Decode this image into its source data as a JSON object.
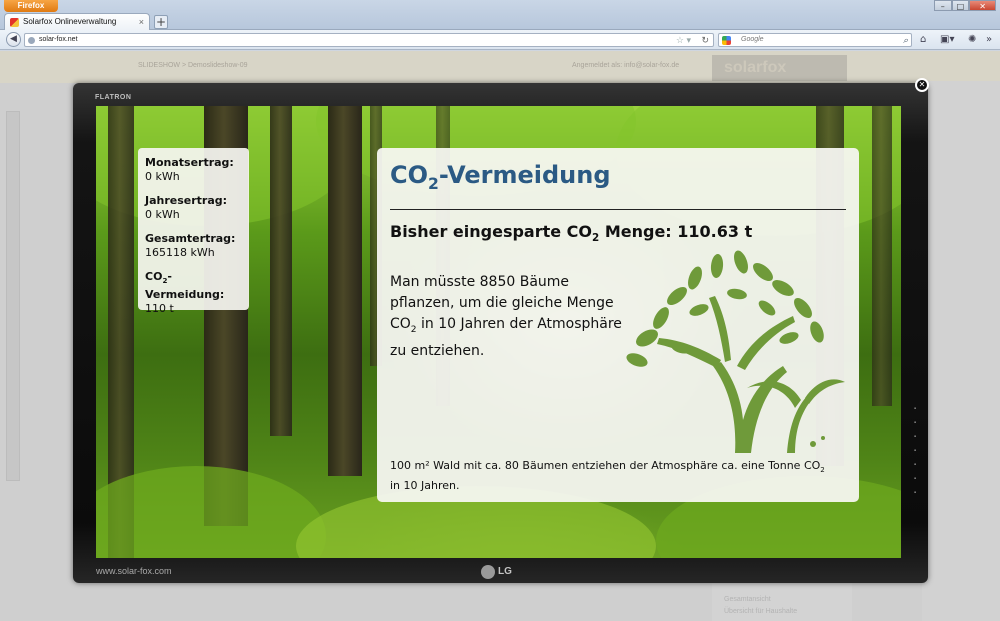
{
  "browser": {
    "app_button": "Firefox",
    "tab_title": "Solarfox Onlineverwaltung",
    "new_tab": "+",
    "url": "solar-fox.net",
    "search_placeholder": "Google"
  },
  "site": {
    "breadcrumb": "SLIDESHOW > Demoslideshow-09",
    "login_text": "Angemeldet als: info@solar-fox.de",
    "logo_text": "solarfox",
    "links": [
      "Gesamtansicht",
      "Übersicht für Haushalte"
    ]
  },
  "monitor": {
    "brand": "FLATRON",
    "url": "www.solar-fox.com",
    "maker": "LG"
  },
  "stats": [
    {
      "label": "Monatsertrag:",
      "value": "0 kWh"
    },
    {
      "label": "Jahresertrag:",
      "value": "0 kWh"
    },
    {
      "label": "Gesamtertrag:",
      "value": "165118 kWh"
    },
    {
      "label_prefix": "CO",
      "label_sub": "2",
      "label_suffix": "-Vermeidung:",
      "value": "110 t"
    }
  ],
  "panel": {
    "title_prefix": "CO",
    "title_sub": "2",
    "title_suffix": "-Vermeidung",
    "subtitle_prefix": "Bisher eingesparte CO",
    "subtitle_sub": "2",
    "subtitle_suffix": " Menge: 110.63 t",
    "body_1": "Man müsste 8850 Bäume pflanzen, um die gleiche Menge CO",
    "body_sub": "2",
    "body_2": " in 10 Jahren der Atmosphäre zu entziehen.",
    "foot_1": "100 m² Wald mit ca. 80 Bäumen entziehen der Atmosphäre ca. eine Tonne CO",
    "foot_sub": "2",
    "foot_2": " in 10 Jahren."
  },
  "colors": {
    "title_blue": "#2b5a84",
    "tree_green": "#6f9a3a"
  }
}
